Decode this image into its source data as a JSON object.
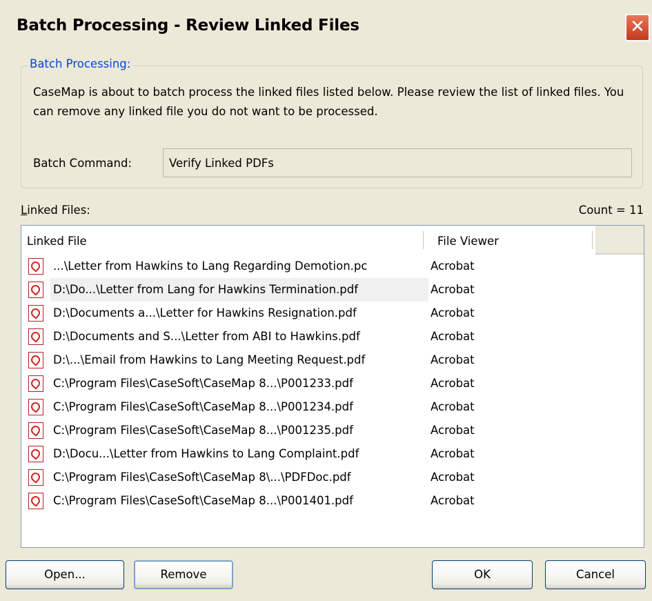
{
  "window": {
    "title": "Batch Processing - Review Linked Files",
    "close_label": "✕"
  },
  "group": {
    "legend": "Batch Processing:",
    "description": "CaseMap is about to batch process the linked files listed below.  Please review the list of linked files.  You can remove any linked file you do not want to be processed.",
    "command_label": "Batch Command:",
    "command_value": "Verify Linked PDFs"
  },
  "files": {
    "label_prefix": "L",
    "label_rest": "inked Files:",
    "count_text": "Count = 11",
    "columns": [
      "Linked File",
      "File Viewer"
    ],
    "rows": [
      {
        "file": "...\\Letter from Hawkins to Lang Regarding Demotion.pc",
        "viewer": "Acrobat"
      },
      {
        "file": "D:\\Do...\\Letter from Lang for Hawkins Termination.pdf",
        "viewer": "Acrobat"
      },
      {
        "file": "D:\\Documents a...\\Letter for Hawkins Resignation.pdf",
        "viewer": "Acrobat"
      },
      {
        "file": "D:\\Documents and S...\\Letter from ABI to Hawkins.pdf",
        "viewer": "Acrobat"
      },
      {
        "file": "D:\\...\\Email from Hawkins to Lang Meeting Request.pdf",
        "viewer": "Acrobat"
      },
      {
        "file": "C:\\Program Files\\CaseSoft\\CaseMap 8...\\P001233.pdf",
        "viewer": "Acrobat"
      },
      {
        "file": "C:\\Program Files\\CaseSoft\\CaseMap 8...\\P001234.pdf",
        "viewer": "Acrobat"
      },
      {
        "file": "C:\\Program Files\\CaseSoft\\CaseMap 8...\\P001235.pdf",
        "viewer": "Acrobat"
      },
      {
        "file": "D:\\Docu...\\Letter from Hawkins to Lang Complaint.pdf",
        "viewer": "Acrobat"
      },
      {
        "file": "C:\\Program Files\\CaseSoft\\CaseMap 8\\...\\PDFDoc.pdf",
        "viewer": "Acrobat"
      },
      {
        "file": "C:\\Program Files\\CaseSoft\\CaseMap 8...\\P001401.pdf",
        "viewer": "Acrobat"
      }
    ],
    "selected_row": 1,
    "icon": "pdf-file-icon"
  },
  "buttons": {
    "open": "Open...",
    "remove": "Remove",
    "ok": "OK",
    "cancel": "Cancel"
  }
}
